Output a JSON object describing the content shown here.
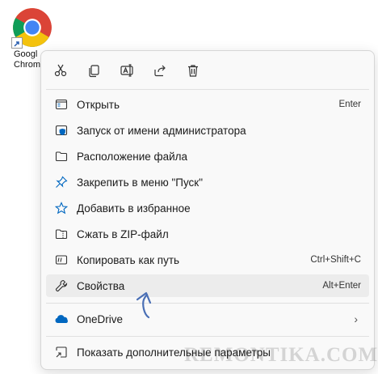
{
  "desktop": {
    "shortcut_label": "Googl\nChrom"
  },
  "toolbar": {
    "buttons": [
      {
        "icon": "cut-icon"
      },
      {
        "icon": "copy-icon"
      },
      {
        "icon": "rename-icon"
      },
      {
        "icon": "share-icon"
      },
      {
        "icon": "delete-icon"
      }
    ]
  },
  "menu": {
    "items": [
      {
        "label": "Открыть",
        "shortcut": "Enter",
        "icon": "open-window-icon"
      },
      {
        "label": "Запуск от имени администратора",
        "icon": "admin-shield-icon"
      },
      {
        "label": "Расположение файла",
        "icon": "folder-icon"
      },
      {
        "label": "Закрепить в меню \"Пуск\"",
        "icon": "pin-icon"
      },
      {
        "label": "Добавить в избранное",
        "icon": "star-icon"
      },
      {
        "label": "Сжать в ZIP-файл",
        "icon": "zip-folder-icon"
      },
      {
        "label": "Копировать как путь",
        "shortcut": "Ctrl+Shift+C",
        "icon": "copy-path-icon"
      },
      {
        "label": "Свойства",
        "shortcut": "Alt+Enter",
        "icon": "wrench-icon"
      },
      {
        "label": "OneDrive",
        "icon": "onedrive-cloud-icon"
      },
      {
        "label": "Показать дополнительные параметры",
        "icon": "more-options-icon"
      }
    ]
  },
  "watermark": "REMONTIKA.COM",
  "colors": {
    "accent": "#0067c0",
    "arrow": "#4a6fb5",
    "hover": "#ececec"
  }
}
